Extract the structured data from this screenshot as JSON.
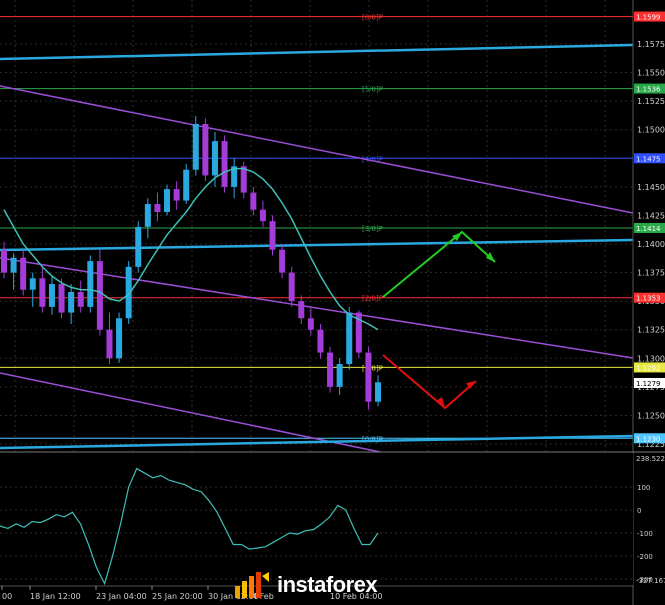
{
  "chart_data": {
    "type": "line",
    "price_axis_ticks": [
      "1.1575",
      "1.1550",
      "1.1525",
      "1.1500",
      "1.1475",
      "1.1450",
      "1.1425",
      "1.1400",
      "1.1375",
      "1.1350",
      "1.1325",
      "1.1300",
      "1.1275",
      "1.1250",
      "1.1225"
    ],
    "time_axis_ticks": [
      "00",
      "18 Jan 12:00",
      "23 Jan 04:00",
      "25 Jan 20:00",
      "30 Jan 12:00",
      "4 Feb",
      "10 Feb 04:00"
    ],
    "levels": [
      {
        "label": "[8/8]P",
        "price": 1.1599,
        "badge": "1.1599",
        "color": "#ff3030"
      },
      {
        "label": "[5/8]P",
        "price": 1.1536,
        "badge": "1.1536",
        "color": "#2aa84a"
      },
      {
        "label": "[4/8]P",
        "price": 1.1475,
        "badge": "1.1475",
        "color": "#3050ff"
      },
      {
        "label": "[3/8]P",
        "price": 1.1414,
        "badge": "1.1414",
        "color": "#2aa84a"
      },
      {
        "label": "[2/8]P",
        "price": 1.1353,
        "badge": "1.1353",
        "color": "#ff3030"
      },
      {
        "label": "[1/8]P",
        "price": 1.1292,
        "badge": "1.1292",
        "color": "#e8e840"
      },
      {
        "label": "[0/8]P",
        "price": 1.123,
        "badge": "1.1230",
        "color": "#4fc6ff"
      }
    ],
    "current_price": "1.1279",
    "ma_period_note": "",
    "candles": [
      {
        "o": 1.1395,
        "h": 1.1402,
        "l": 1.137,
        "c": 1.1375
      },
      {
        "o": 1.1375,
        "h": 1.1392,
        "l": 1.136,
        "c": 1.1388
      },
      {
        "o": 1.1388,
        "h": 1.1395,
        "l": 1.1355,
        "c": 1.136
      },
      {
        "o": 1.136,
        "h": 1.1375,
        "l": 1.1345,
        "c": 1.137
      },
      {
        "o": 1.137,
        "h": 1.138,
        "l": 1.134,
        "c": 1.1345
      },
      {
        "o": 1.1345,
        "h": 1.1372,
        "l": 1.1338,
        "c": 1.1365
      },
      {
        "o": 1.1365,
        "h": 1.137,
        "l": 1.1335,
        "c": 1.134
      },
      {
        "o": 1.134,
        "h": 1.1365,
        "l": 1.133,
        "c": 1.1358
      },
      {
        "o": 1.1358,
        "h": 1.1368,
        "l": 1.134,
        "c": 1.1345
      },
      {
        "o": 1.1345,
        "h": 1.139,
        "l": 1.134,
        "c": 1.1385
      },
      {
        "o": 1.1385,
        "h": 1.1395,
        "l": 1.132,
        "c": 1.1325
      },
      {
        "o": 1.1325,
        "h": 1.134,
        "l": 1.1295,
        "c": 1.13
      },
      {
        "o": 1.13,
        "h": 1.134,
        "l": 1.1296,
        "c": 1.1335
      },
      {
        "o": 1.1335,
        "h": 1.1385,
        "l": 1.133,
        "c": 1.138
      },
      {
        "o": 1.138,
        "h": 1.142,
        "l": 1.1375,
        "c": 1.1415
      },
      {
        "o": 1.1415,
        "h": 1.144,
        "l": 1.1405,
        "c": 1.1435
      },
      {
        "o": 1.1435,
        "h": 1.1445,
        "l": 1.142,
        "c": 1.1428
      },
      {
        "o": 1.1428,
        "h": 1.1452,
        "l": 1.1425,
        "c": 1.1448
      },
      {
        "o": 1.1448,
        "h": 1.1455,
        "l": 1.143,
        "c": 1.1438
      },
      {
        "o": 1.1438,
        "h": 1.147,
        "l": 1.1435,
        "c": 1.1465
      },
      {
        "o": 1.1465,
        "h": 1.1512,
        "l": 1.146,
        "c": 1.1505
      },
      {
        "o": 1.1505,
        "h": 1.151,
        "l": 1.1455,
        "c": 1.146
      },
      {
        "o": 1.146,
        "h": 1.1498,
        "l": 1.145,
        "c": 1.149
      },
      {
        "o": 1.149,
        "h": 1.1495,
        "l": 1.1445,
        "c": 1.145
      },
      {
        "o": 1.145,
        "h": 1.1475,
        "l": 1.144,
        "c": 1.1468
      },
      {
        "o": 1.1468,
        "h": 1.1472,
        "l": 1.144,
        "c": 1.1445
      },
      {
        "o": 1.1445,
        "h": 1.145,
        "l": 1.1425,
        "c": 1.143
      },
      {
        "o": 1.143,
        "h": 1.1438,
        "l": 1.1415,
        "c": 1.142
      },
      {
        "o": 1.142,
        "h": 1.1425,
        "l": 1.139,
        "c": 1.1395
      },
      {
        "o": 1.1395,
        "h": 1.14,
        "l": 1.137,
        "c": 1.1375
      },
      {
        "o": 1.1375,
        "h": 1.138,
        "l": 1.1345,
        "c": 1.135
      },
      {
        "o": 1.135,
        "h": 1.1355,
        "l": 1.133,
        "c": 1.1335
      },
      {
        "o": 1.1335,
        "h": 1.1345,
        "l": 1.132,
        "c": 1.1325
      },
      {
        "o": 1.1325,
        "h": 1.133,
        "l": 1.13,
        "c": 1.1305
      },
      {
        "o": 1.1305,
        "h": 1.131,
        "l": 1.127,
        "c": 1.1275
      },
      {
        "o": 1.1275,
        "h": 1.13,
        "l": 1.1268,
        "c": 1.1295
      },
      {
        "o": 1.1295,
        "h": 1.1345,
        "l": 1.129,
        "c": 1.134
      },
      {
        "o": 1.134,
        "h": 1.1342,
        "l": 1.13,
        "c": 1.1305
      },
      {
        "o": 1.1305,
        "h": 1.131,
        "l": 1.1255,
        "c": 1.1262
      },
      {
        "o": 1.1262,
        "h": 1.1285,
        "l": 1.1258,
        "c": 1.1279
      }
    ],
    "ma": [
      1.143,
      1.1415,
      1.14,
      1.139,
      1.138,
      1.1372,
      1.1366,
      1.1362,
      1.136,
      1.136,
      1.1358,
      1.1352,
      1.135,
      1.1356,
      1.1368,
      1.1382,
      1.1395,
      1.1408,
      1.1418,
      1.1428,
      1.144,
      1.145,
      1.1458,
      1.1463,
      1.1466,
      1.1466,
      1.1463,
      1.1457,
      1.1448,
      1.1436,
      1.1422,
      1.1405,
      1.1388,
      1.1372,
      1.1358,
      1.1346,
      1.1338,
      1.1334,
      1.133,
      1.1325
    ],
    "oscillator": {
      "range_top": "238.5227",
      "range_bottom": "-327.167",
      "ticks": [
        "100",
        "0",
        "-100",
        "-200",
        "-300"
      ],
      "values": [
        -70,
        -80,
        -60,
        -75,
        -50,
        -55,
        -40,
        -20,
        -30,
        -10,
        -60,
        -150,
        -250,
        -320,
        -200,
        -60,
        100,
        180,
        160,
        140,
        150,
        130,
        120,
        110,
        90,
        80,
        40,
        -10,
        -80,
        -150,
        -150,
        -170,
        -165,
        -160,
        -140,
        -120,
        -100,
        -105,
        -90,
        -85,
        -60,
        -30,
        20,
        0,
        -80,
        -150,
        -150,
        -100
      ]
    },
    "forecast_arrows": [
      {
        "color": "#22cc22",
        "direction": "up-then-down"
      },
      {
        "color": "#e01010",
        "direction": "down-then-up"
      }
    ]
  },
  "watermark": {
    "brand": "instaforex"
  }
}
